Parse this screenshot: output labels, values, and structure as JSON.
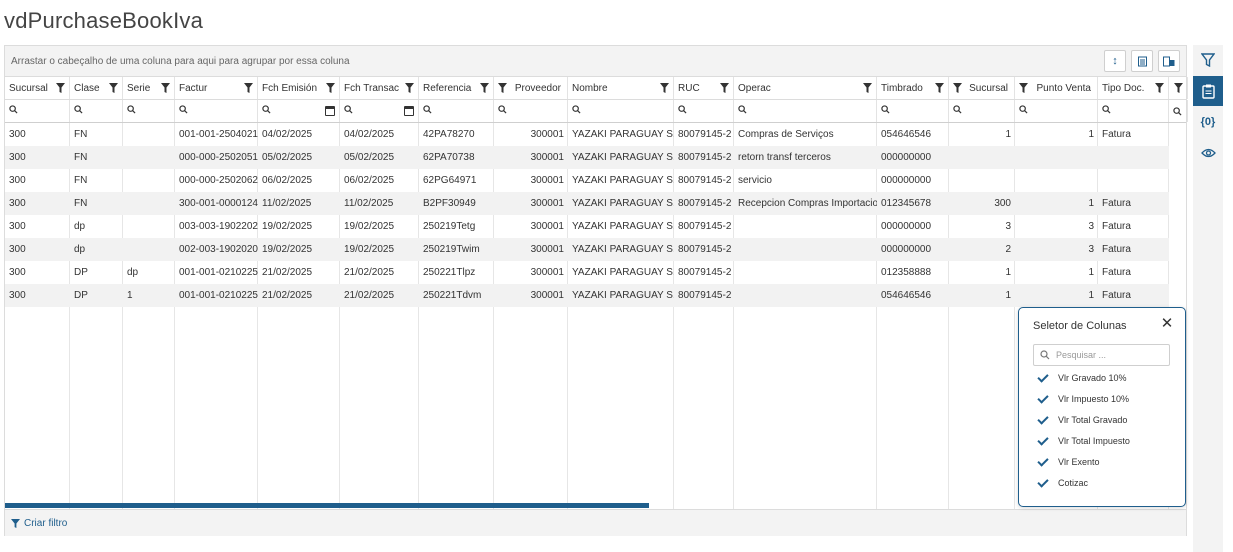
{
  "page_title": "vdPurchaseBookIva",
  "group_panel_text": "Arrastar o cabeçalho de uma coluna para aqui para agrupar por essa coluna",
  "columns": [
    {
      "label": "Sucursal"
    },
    {
      "label": "Clase"
    },
    {
      "label": "Serie"
    },
    {
      "label": "Factur"
    },
    {
      "label": "Fch Emisión"
    },
    {
      "label": "Fch Transac"
    },
    {
      "label": "Referencia"
    },
    {
      "label": "Proveedor"
    },
    {
      "label": "Nombre"
    },
    {
      "label": "RUC"
    },
    {
      "label": "Operac"
    },
    {
      "label": "Timbrado"
    },
    {
      "label": "Sucursal"
    },
    {
      "label": "Punto Venta"
    },
    {
      "label": "Tipo Doc."
    }
  ],
  "rows": [
    [
      "300",
      "FN",
      "",
      "001-001-2504021",
      "04/02/2025",
      "04/02/2025",
      "42PA78270",
      "300001",
      "YAZAKI PARAGUAY S.A.",
      "80079145-2",
      "Compras de Serviços",
      "054646546",
      "1",
      "1",
      "Fatura"
    ],
    [
      "300",
      "FN",
      "",
      "000-000-2502051",
      "05/02/2025",
      "05/02/2025",
      "62PA70738",
      "300001",
      "YAZAKI PARAGUAY S.A.",
      "80079145-2",
      "retorn transf terceros",
      "000000000",
      "",
      "",
      ""
    ],
    [
      "300",
      "FN",
      "",
      "000-000-2502062",
      "06/02/2025",
      "06/02/2025",
      "62PG64971",
      "300001",
      "YAZAKI PARAGUAY S.A.",
      "80079145-2",
      "servicio",
      "000000000",
      "",
      "",
      ""
    ],
    [
      "300",
      "FN",
      "",
      "300-001-0000124",
      "11/02/2025",
      "11/02/2025",
      "B2PF30949",
      "300001",
      "YAZAKI PARAGUAY S.A.",
      "80079145-2",
      "Recepcion Compras Importacion",
      "012345678",
      "300",
      "1",
      "Fatura"
    ],
    [
      "300",
      "dp",
      "",
      "003-003-1902202",
      "19/02/2025",
      "19/02/2025",
      "250219Tetg",
      "300001",
      "YAZAKI PARAGUAY S.A.",
      "80079145-2",
      "",
      "000000000",
      "3",
      "3",
      "Fatura"
    ],
    [
      "300",
      "dp",
      "",
      "002-003-1902020",
      "19/02/2025",
      "19/02/2025",
      "250219Twim",
      "300001",
      "YAZAKI PARAGUAY S.A.",
      "80079145-2",
      "",
      "000000000",
      "2",
      "3",
      "Fatura"
    ],
    [
      "300",
      "DP",
      "dp",
      "001-001-0210225",
      "21/02/2025",
      "21/02/2025",
      "250221Tlpz",
      "300001",
      "YAZAKI PARAGUAY S.A.",
      "80079145-2",
      "",
      "012358888",
      "1",
      "1",
      "Fatura"
    ],
    [
      "300",
      "DP",
      "1",
      "001-001-0210225",
      "21/02/2025",
      "21/02/2025",
      "250221Tdvm",
      "300001",
      "YAZAKI PARAGUAY S.A.",
      "80079145-2",
      "",
      "054646546",
      "1",
      "1",
      "Fatura"
    ]
  ],
  "footer": {
    "create_filter_label": "Criar filtro"
  },
  "column_chooser": {
    "title": "Seletor de Colunas",
    "search_placeholder": "Pesquisar ...",
    "items": [
      {
        "label": "Vlr Gravado 10%",
        "checked": true
      },
      {
        "label": "Vlr Impuesto 10%",
        "checked": true
      },
      {
        "label": "Vlr Total Gravado",
        "checked": true
      },
      {
        "label": "Vlr Total Impuesto",
        "checked": true
      },
      {
        "label": "Vlr Exento",
        "checked": true
      },
      {
        "label": "Cotizac",
        "checked": true
      }
    ]
  },
  "colors": {
    "accent": "#1f5e8c",
    "alt_row": "#f2f2f2",
    "panel_bg": "#f3f3f3"
  },
  "icons": {
    "toolbar": [
      "sort-icon",
      "export-icon",
      "column-chooser-icon"
    ],
    "rail": [
      "filter-icon",
      "clipboard-icon",
      "variables-icon",
      "eye-icon"
    ]
  }
}
